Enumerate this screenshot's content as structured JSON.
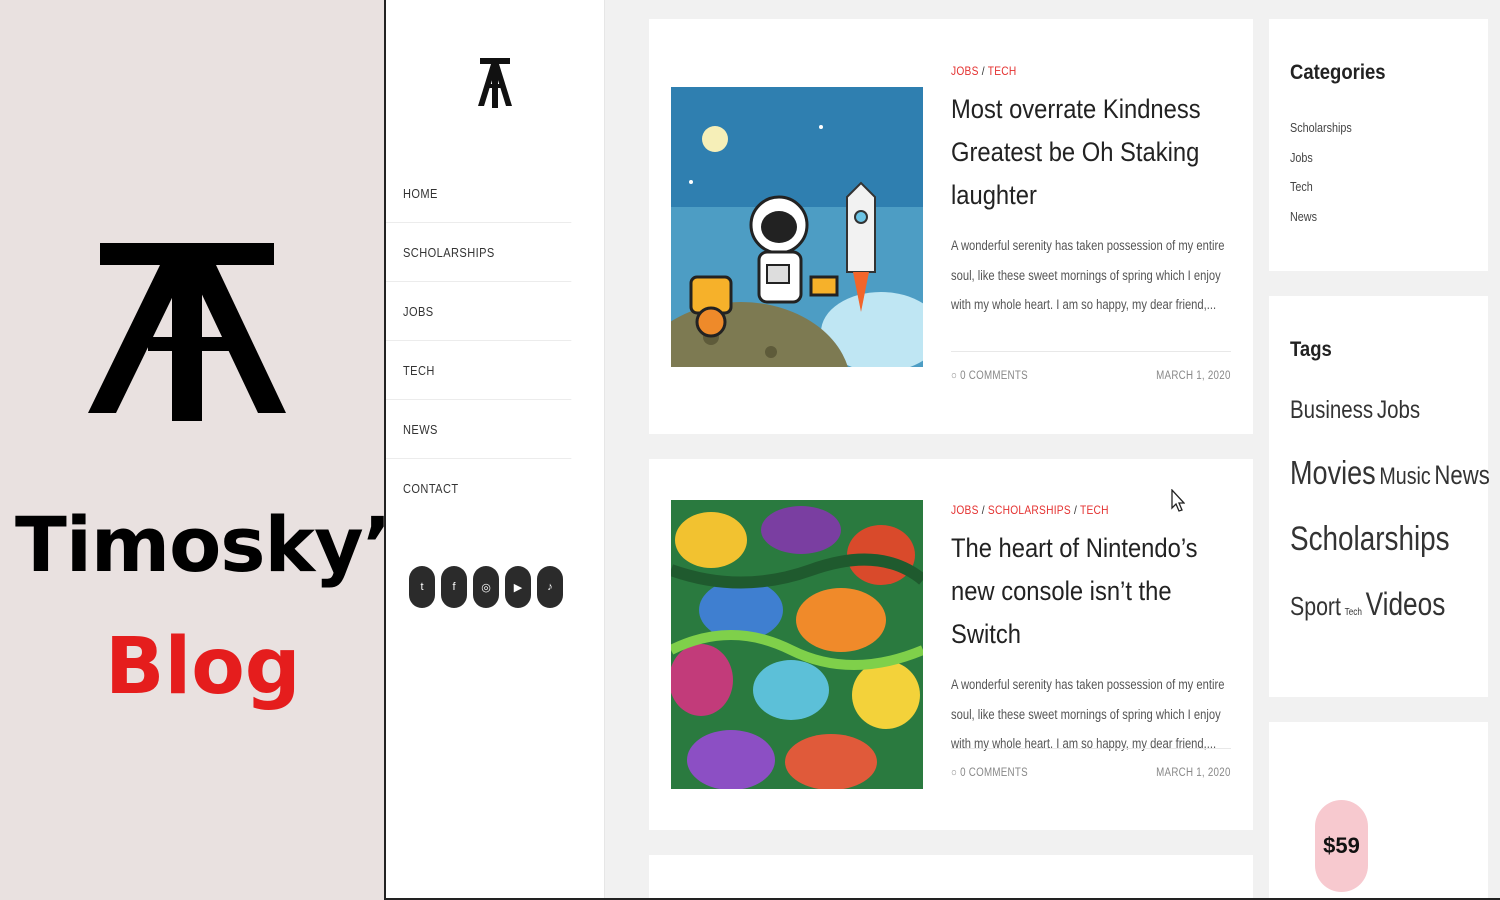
{
  "brand": {
    "title": "Timosky’s",
    "subtitle": "Blog",
    "logo_icon": "ta-monogram-logo"
  },
  "nav": {
    "items": [
      "HOME",
      "SCHOLARSHIPS",
      "JOBS",
      "TECH",
      "NEWS",
      "CONTACT"
    ]
  },
  "socials": [
    {
      "icon": "twitter-icon",
      "glyph": "t"
    },
    {
      "icon": "facebook-icon",
      "glyph": "f"
    },
    {
      "icon": "instagram-icon",
      "glyph": "◎"
    },
    {
      "icon": "youtube-icon",
      "glyph": "▶"
    },
    {
      "icon": "tiktok-icon",
      "glyph": "♪"
    }
  ],
  "posts": [
    {
      "categories": [
        "JOBS",
        "TECH"
      ],
      "title": "Most overrate Kindness Greatest be Oh Staking laughter",
      "excerpt": "A wonderful serenity has taken possession of my entire soul, like these sweet mornings of spring which I enjoy with my whole heart. I am so happy, my dear friend,...",
      "comments": "0 COMMENTS",
      "date": "MARCH 1, 2020"
    },
    {
      "categories": [
        "JOBS",
        "SCHOLARSHIPS",
        "TECH"
      ],
      "title": "The heart of Nintendo’s new console isn’t the Switch",
      "excerpt": "A wonderful serenity has taken possession of my entire soul, like these sweet mornings of spring which I enjoy with my whole heart. I am so happy, my dear friend,...",
      "comments": "0 COMMENTS",
      "date": "MARCH 1, 2020"
    }
  ],
  "sidebar": {
    "categories_title": "Categories",
    "categories": [
      "Scholarships",
      "Jobs",
      "Tech",
      "News"
    ],
    "tags_title": "Tags",
    "tags": [
      "Business",
      "Jobs",
      "Movies",
      "Music",
      "News",
      "Scholarships",
      "Sport",
      "Tech",
      "Videos"
    ],
    "promo_price": "$59"
  },
  "colors": {
    "accent": "#e4302f",
    "brand_red": "#e51d1d"
  }
}
